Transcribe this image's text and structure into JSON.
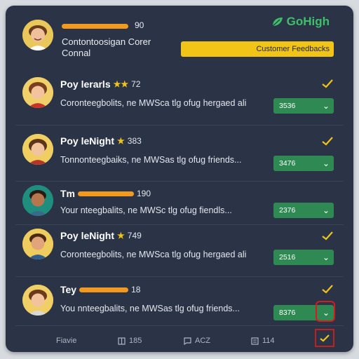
{
  "brand": {
    "name": "GoHigh",
    "logo_icon": "brand-leaf-icon",
    "color": "#3fbf6a"
  },
  "header": {
    "count": "90",
    "subtitle": "Contontoosigan Corer Connal",
    "banner": "Customer Feedbacks"
  },
  "rows": [
    {
      "name": "Poy lerarls",
      "stars": "★★",
      "score": "72",
      "text": "Coronteegbolits, ne MWSca tlg ofug hergaed ali",
      "pill": "3536",
      "pill_caret": "⌄"
    },
    {
      "name": "Poy leNight",
      "stars": "★",
      "score": "383",
      "text": "Tonnonteegbaiks, ne MWSas tlg ofug friends...",
      "pill": "3476",
      "pill_caret": "⌄"
    },
    {
      "name": "Tm",
      "stars": "",
      "score": "190",
      "text": "Your nteegbalits, ne MWSc tlg ofug fiendls...",
      "pill": "2376",
      "pill_caret": "⌄"
    },
    {
      "name": "Poy leNight",
      "stars": "★",
      "score": "749",
      "text": "Coronteegbolits, ne MWSca tlg ofug hergaed ali",
      "pill": "2516",
      "pill_caret": "⌄"
    },
    {
      "name": "Tey",
      "stars": "",
      "score": "18",
      "text": "You nnteegbalits, ne MWSas tlg ofug friends...",
      "pill": "8376",
      "pill_caret": "⌄"
    }
  ],
  "footer": {
    "items": [
      {
        "label": "Fiavie",
        "icon": ""
      },
      {
        "label": "185",
        "icon": "book-icon"
      },
      {
        "label": "ACZ",
        "icon": "chat-icon"
      },
      {
        "label": "114",
        "icon": "list-icon"
      }
    ],
    "action_icon": "check-icon"
  },
  "colors": {
    "panel": "#2a3446",
    "accent_orange": "#f29a1f",
    "accent_yellow": "#f2c418",
    "pill_green": "#2e8a52",
    "highlight_red": "#d41c1c"
  }
}
